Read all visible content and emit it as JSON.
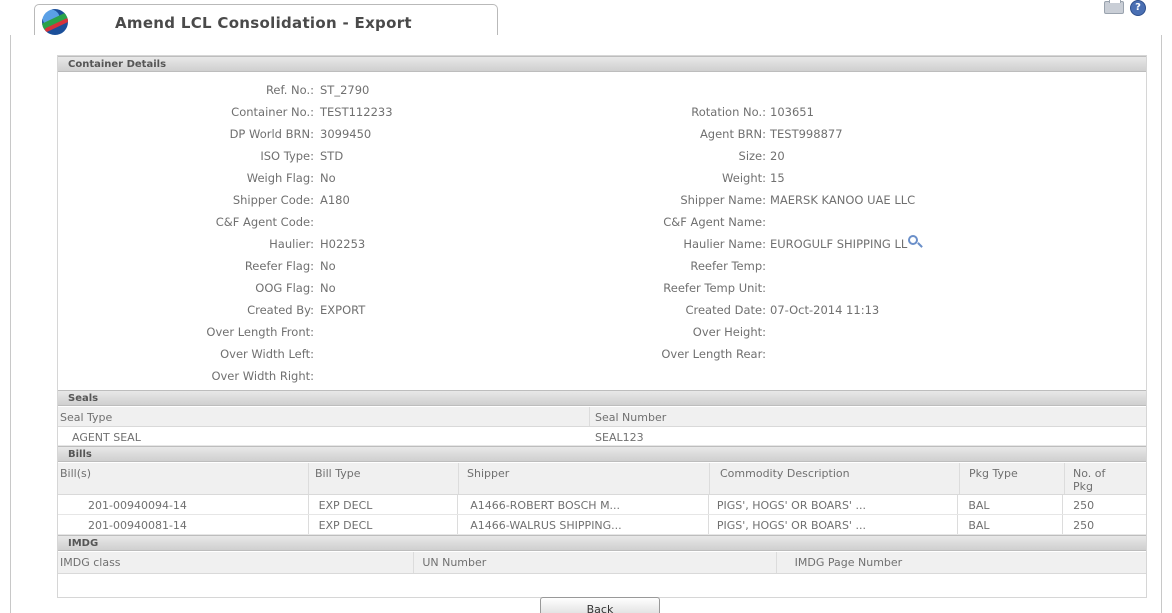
{
  "header": {
    "title": "Amend LCL Consolidation - Export",
    "help_glyph": "?"
  },
  "container_details": {
    "section_title": "Container Details",
    "fields": {
      "ref_no": {
        "label": "Ref. No.:",
        "value": "ST_2790"
      },
      "container_no": {
        "label": "Container No.:",
        "value": "TEST112233"
      },
      "rotation_no": {
        "label": "Rotation No.:",
        "value": "103651"
      },
      "dp_world_brn": {
        "label": "DP World BRN:",
        "value": "3099450"
      },
      "agent_brn": {
        "label": "Agent BRN:",
        "value": "TEST998877"
      },
      "iso_type": {
        "label": "ISO Type:",
        "value": "STD"
      },
      "size": {
        "label": "Size:",
        "value": "20"
      },
      "weigh_flag": {
        "label": "Weigh Flag:",
        "value": "No"
      },
      "weight": {
        "label": "Weight:",
        "value": "15"
      },
      "shipper_code": {
        "label": "Shipper Code:",
        "value": "A180"
      },
      "shipper_name": {
        "label": "Shipper Name:",
        "value": "MAERSK KANOO UAE LLC"
      },
      "cf_agent_code": {
        "label": "C&F Agent Code:",
        "value": ""
      },
      "cf_agent_name": {
        "label": "C&F Agent Name:",
        "value": ""
      },
      "haulier": {
        "label": "Haulier:",
        "value": "H02253"
      },
      "haulier_name": {
        "label": "Haulier Name:",
        "value": "EUROGULF SHIPPING LL"
      },
      "reefer_flag": {
        "label": "Reefer Flag:",
        "value": "No"
      },
      "reefer_temp": {
        "label": "Reefer Temp:",
        "value": ""
      },
      "oog_flag": {
        "label": "OOG Flag:",
        "value": "No"
      },
      "reefer_temp_unit": {
        "label": "Reefer Temp Unit:",
        "value": ""
      },
      "created_by": {
        "label": "Created By:",
        "value": "EXPORT"
      },
      "created_date": {
        "label": "Created Date:",
        "value": "07-Oct-2014 11:13"
      },
      "over_length_front": {
        "label": "Over Length Front:",
        "value": ""
      },
      "over_height": {
        "label": "Over Height:",
        "value": ""
      },
      "over_width_left": {
        "label": "Over Width Left:",
        "value": ""
      },
      "over_length_rear": {
        "label": "Over Length Rear:",
        "value": ""
      },
      "over_width_right": {
        "label": "Over Width Right:",
        "value": ""
      }
    }
  },
  "seals": {
    "section_title": "Seals",
    "columns": [
      "Seal Type",
      "Seal Number"
    ],
    "rows": [
      [
        "AGENT SEAL",
        "SEAL123"
      ]
    ]
  },
  "bills": {
    "section_title": "Bills",
    "columns": [
      "Bill(s)",
      "Bill Type",
      "Shipper",
      "Commodity Description",
      "Pkg Type",
      "No. of Pkg"
    ],
    "rows": [
      [
        "201-00940094-14",
        "EXP DECL",
        "A1466-ROBERT BOSCH M...",
        "PIGS', HOGS' OR BOARS' ...",
        "BAL",
        "250"
      ],
      [
        "201-00940081-14",
        "EXP DECL",
        "A1466-WALRUS SHIPPING...",
        "PIGS', HOGS' OR BOARS' ...",
        "BAL",
        "250"
      ]
    ]
  },
  "imdg": {
    "section_title": "IMDG",
    "columns": [
      "IMDG class",
      "UN Number",
      "IMDG Page Number"
    ]
  },
  "actions": {
    "back_label": "Back"
  }
}
